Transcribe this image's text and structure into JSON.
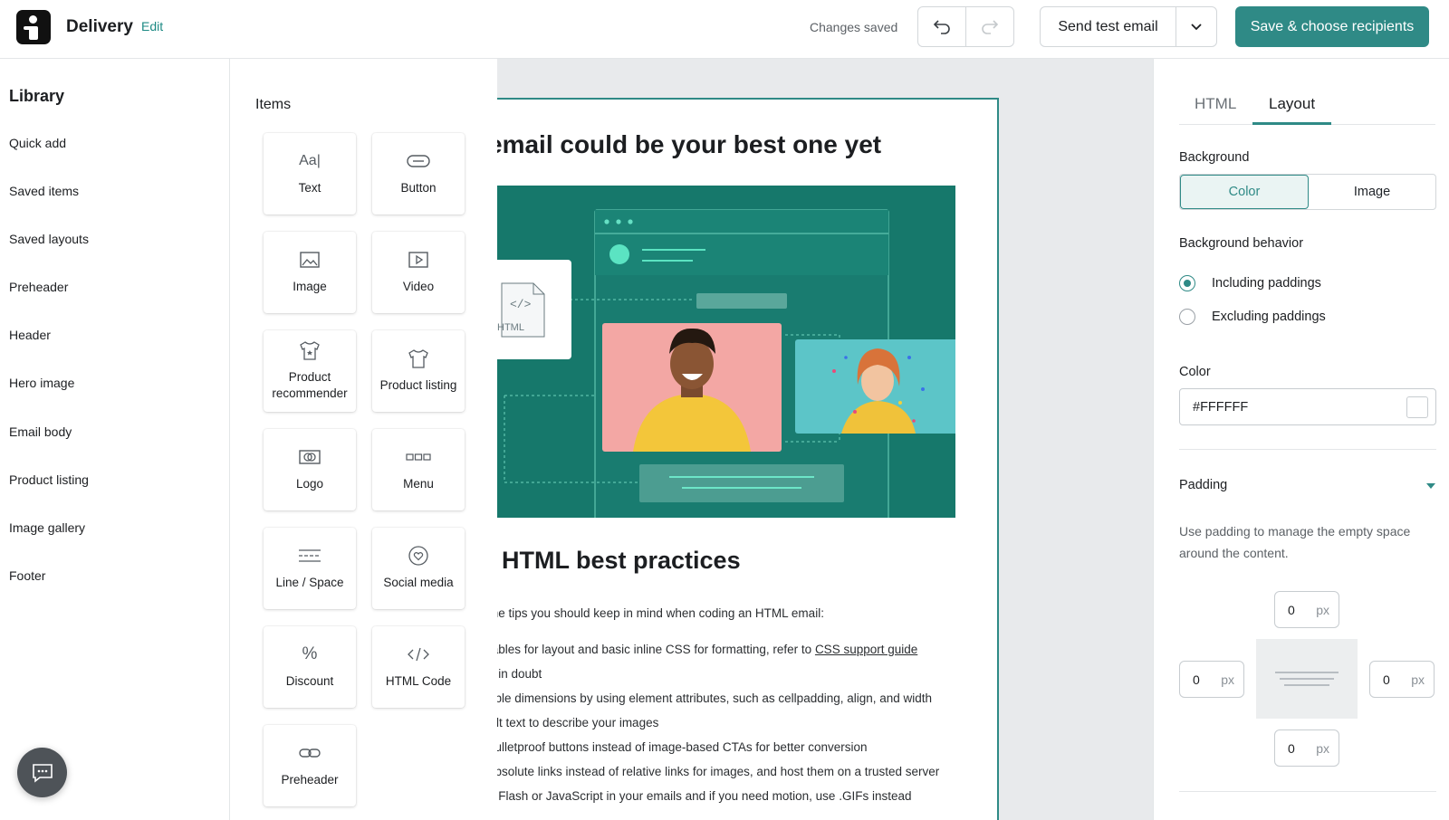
{
  "header": {
    "app_title": "Delivery",
    "edit_label": "Edit",
    "save_status": "Changes saved",
    "send_test_label": "Send test email",
    "save_button_label": "Save & choose recipients",
    "accent_color": "#2f8a86"
  },
  "library": {
    "title": "Library",
    "items": [
      {
        "label": "Quick add"
      },
      {
        "label": "Saved items"
      },
      {
        "label": "Saved layouts"
      },
      {
        "label": "Preheader"
      },
      {
        "label": "Header"
      },
      {
        "label": "Hero image"
      },
      {
        "label": "Email body"
      },
      {
        "label": "Product listing"
      },
      {
        "label": "Image gallery"
      },
      {
        "label": "Footer"
      }
    ]
  },
  "items_panel": {
    "title": "Items",
    "tiles": [
      {
        "label": "Text",
        "icon": "text-icon"
      },
      {
        "label": "Button",
        "icon": "button-icon"
      },
      {
        "label": "Image",
        "icon": "image-icon"
      },
      {
        "label": "Video",
        "icon": "video-icon"
      },
      {
        "label": "Product recommender",
        "icon": "tshirt-star-icon"
      },
      {
        "label": "Product listing",
        "icon": "tshirt-icon"
      },
      {
        "label": "Logo",
        "icon": "logo-icon"
      },
      {
        "label": "Menu",
        "icon": "menu-icon"
      },
      {
        "label": "Line / Space",
        "icon": "line-space-icon"
      },
      {
        "label": "Social media",
        "icon": "heart-icon"
      },
      {
        "label": "Discount",
        "icon": "percent-icon"
      },
      {
        "label": "HTML Code",
        "icon": "code-icon"
      },
      {
        "label": "Preheader",
        "icon": "link-icon"
      }
    ]
  },
  "email": {
    "heading": "email could be your best one yet",
    "hero_html_label": "HTML",
    "subheading": "HTML best practices",
    "intro": "me tips you should keep in mind when coding an HTML email:",
    "tips": [
      {
        "text": "tables for layout and basic inline CSS for formatting, refer to ",
        "link": "CSS support guide"
      },
      {
        "text": "n in doubt",
        "link": ""
      },
      {
        "text": "able dimensions by using element attributes, such as cellpadding, align, and width",
        "link": ""
      },
      {
        "text": "Alt text to describe your images",
        "link": ""
      },
      {
        "text": "bulletproof buttons instead of image-based CTAs for better conversion",
        "link": ""
      },
      {
        "text": "absolute links instead of relative links for images, and host them on a trusted server",
        "link": ""
      },
      {
        "text": "d Flash or JavaScript in your emails and if you need motion, use .GIFs instead",
        "link": ""
      }
    ]
  },
  "right_panel": {
    "tabs": [
      {
        "label": "HTML",
        "active": false
      },
      {
        "label": "Layout",
        "active": true
      }
    ],
    "background_label": "Background",
    "background_options": [
      "Color",
      "Image"
    ],
    "background_selected": "Color",
    "behavior_label": "Background behavior",
    "behavior_options": [
      "Including paddings",
      "Excluding paddings"
    ],
    "behavior_selected": "Including paddings",
    "color_label": "Color",
    "color_value": "#FFFFFF",
    "padding_label": "Padding",
    "padding_help": "Use padding to manage the empty space around the content.",
    "padding": {
      "top": "0",
      "left": "0",
      "right": "0",
      "bottom": "0",
      "unit": "px"
    }
  }
}
